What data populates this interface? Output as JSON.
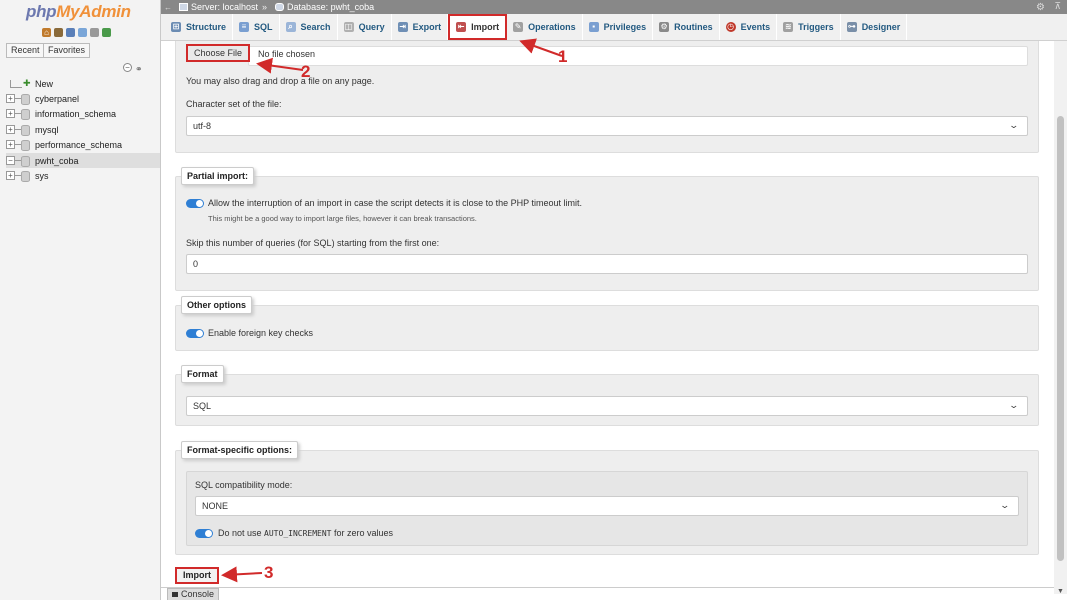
{
  "logo": {
    "php": "php",
    "myadmin": "MyAdmin"
  },
  "sidebar": {
    "tabs": [
      "Recent",
      "Favorites"
    ],
    "tree": [
      {
        "label": "New"
      },
      {
        "label": "cyberpanel"
      },
      {
        "label": "information_schema"
      },
      {
        "label": "mysql"
      },
      {
        "label": "performance_schema"
      },
      {
        "label": "pwht_coba"
      },
      {
        "label": "sys"
      }
    ]
  },
  "breadcrumb": {
    "server": "Server: localhost",
    "separator": "»",
    "database": "Database: pwht_coba"
  },
  "tabs": [
    "Structure",
    "SQL",
    "Search",
    "Query",
    "Export",
    "Import",
    "Operations",
    "Privileges",
    "Routines",
    "Events",
    "Triggers",
    "Designer"
  ],
  "file_section": {
    "choose_button": "Choose File",
    "no_file": "No file chosen",
    "drag_hint": "You may also drag and drop a file on any page.",
    "charset_label": "Character set of the file:",
    "charset_value": "utf-8"
  },
  "partial_import": {
    "legend": "Partial import:",
    "allow_interrupt": "Allow the interruption of an import in case the script detects it is close to the PHP timeout limit.",
    "allow_interrupt_hint": "This might be a good way to import large files, however it can break transactions.",
    "skip_label": "Skip this number of queries (for SQL) starting from the first one:",
    "skip_value": "0"
  },
  "other_options": {
    "legend": "Other options",
    "foreign_keys": "Enable foreign key checks"
  },
  "format": {
    "legend": "Format",
    "value": "SQL"
  },
  "format_specific": {
    "legend": "Format-specific options:",
    "compat_label": "SQL compatibility mode:",
    "compat_value": "NONE",
    "auto_inc_pre": "Do not use",
    "auto_inc_code": "AUTO_INCREMENT",
    "auto_inc_post": "for zero values"
  },
  "import_button": "Import",
  "console_label": "Console",
  "annotations": [
    "1",
    "2",
    "3"
  ],
  "colors": {
    "annotation": "#d12a2a",
    "toggle": "#2f7fd4",
    "tab_link": "#235a81"
  }
}
